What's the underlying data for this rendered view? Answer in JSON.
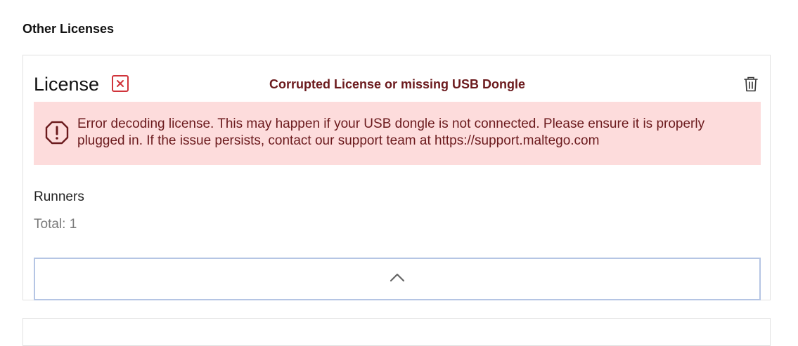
{
  "section": {
    "title": "Other Licenses"
  },
  "license_card": {
    "title": "License",
    "status_icon": "x-box-icon",
    "status_text": "Corrupted License or missing USB Dongle",
    "delete_icon": "trash-icon",
    "error": {
      "icon": "alert-octagon-icon",
      "message": "Error decoding license. This may happen if your USB dongle is not connected. Please ensure it is properly plugged in. If the issue persists, contact our support team at https://support.maltego.com"
    },
    "runners": {
      "label": "Runners",
      "total": "Total: 1"
    },
    "collapse_icon": "chevron-up-icon"
  },
  "colors": {
    "error_bg": "#fddcdc",
    "error_text": "#6b1a1d",
    "badge_red": "#d0343b",
    "button_border": "#b5c5e4"
  }
}
